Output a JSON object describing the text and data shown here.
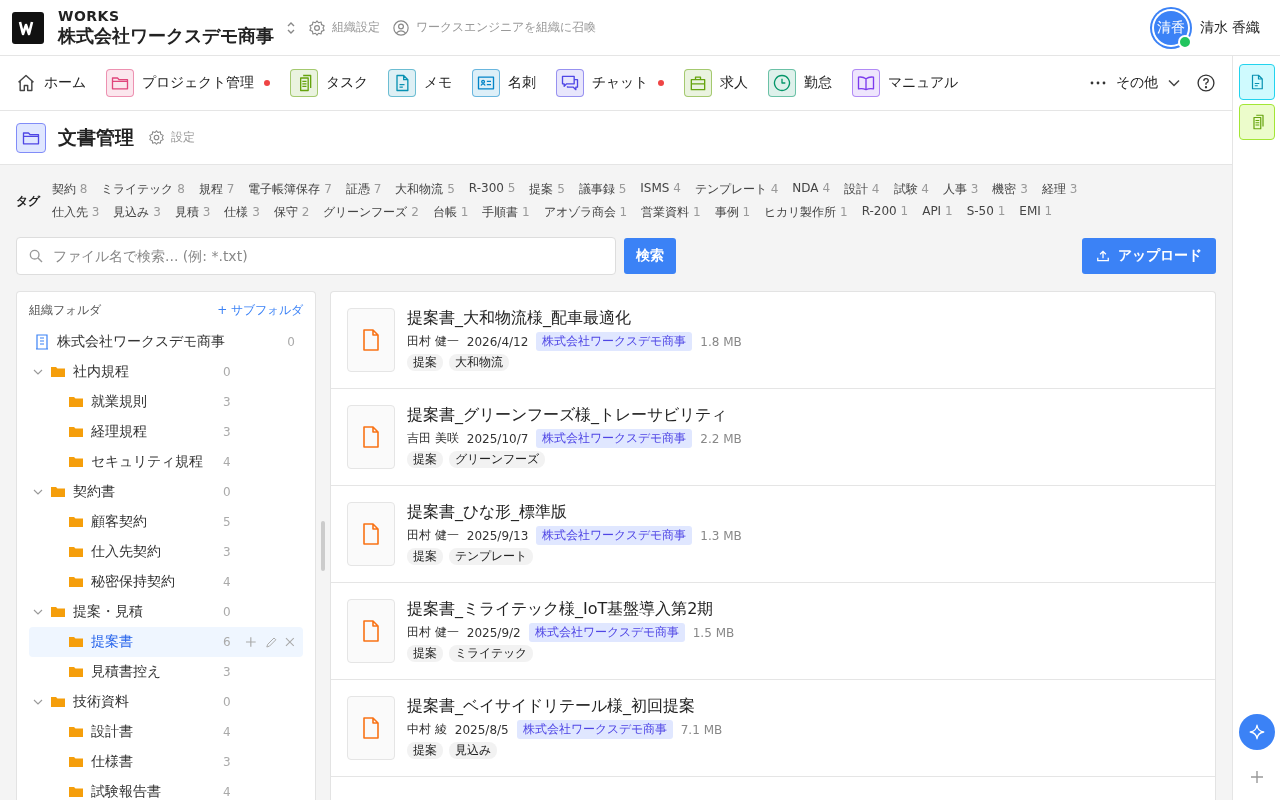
{
  "header": {
    "brand": "WORKS",
    "org": "株式会社ワークスデモ商事",
    "org_settings": "組織設定",
    "summon": "ワークスエンジニアを組織に召喚",
    "user": {
      "initials": "清香",
      "name": "清水 香織",
      "online": true
    }
  },
  "nav": {
    "items": [
      {
        "label": "ホーム",
        "kind": "plain",
        "badge": false
      },
      {
        "label": "プロジェクト管理",
        "kind": "app",
        "color": "#e0457b",
        "badge": true
      },
      {
        "label": "タスク",
        "kind": "app",
        "color": "#65a30d",
        "badge": false
      },
      {
        "label": "メモ",
        "kind": "app",
        "color": "#0891b2",
        "badge": false
      },
      {
        "label": "名刺",
        "kind": "app",
        "color": "#0284c7",
        "badge": false
      },
      {
        "label": "チャット",
        "kind": "app",
        "color": "#4f46e5",
        "badge": true
      },
      {
        "label": "求人",
        "kind": "app",
        "color": "#65a30d",
        "badge": false
      },
      {
        "label": "勤怠",
        "kind": "app",
        "color": "#059669",
        "badge": false
      },
      {
        "label": "マニュアル",
        "kind": "app",
        "color": "#7c3aed",
        "badge": false
      }
    ],
    "more": "その他"
  },
  "page": {
    "title": "文書管理",
    "settings": "設定"
  },
  "tags": {
    "label": "タグ",
    "items": [
      {
        "name": "契約",
        "count": "8"
      },
      {
        "name": "ミライテック",
        "count": "8"
      },
      {
        "name": "規程",
        "count": "7"
      },
      {
        "name": "電子帳簿保存",
        "count": "7"
      },
      {
        "name": "証憑",
        "count": "7"
      },
      {
        "name": "大和物流",
        "count": "5"
      },
      {
        "name": "R-300",
        "count": "5"
      },
      {
        "name": "提案",
        "count": "5"
      },
      {
        "name": "議事録",
        "count": "5"
      },
      {
        "name": "ISMS",
        "count": "4"
      },
      {
        "name": "テンプレート",
        "count": "4"
      },
      {
        "name": "NDA",
        "count": "4"
      },
      {
        "name": "設計",
        "count": "4"
      },
      {
        "name": "試験",
        "count": "4"
      },
      {
        "name": "人事",
        "count": "3"
      },
      {
        "name": "機密",
        "count": "3"
      },
      {
        "name": "経理",
        "count": "3"
      },
      {
        "name": "仕入先",
        "count": "3"
      },
      {
        "name": "見込み",
        "count": "3"
      },
      {
        "name": "見積",
        "count": "3"
      },
      {
        "name": "仕様",
        "count": "3"
      },
      {
        "name": "保守",
        "count": "2"
      },
      {
        "name": "グリーンフーズ",
        "count": "2"
      },
      {
        "name": "台帳",
        "count": "1"
      },
      {
        "name": "手順書",
        "count": "1"
      },
      {
        "name": "アオゾラ商会",
        "count": "1"
      },
      {
        "name": "営業資料",
        "count": "1"
      },
      {
        "name": "事例",
        "count": "1"
      },
      {
        "name": "ヒカリ製作所",
        "count": "1"
      },
      {
        "name": "R-200",
        "count": "1"
      },
      {
        "name": "API",
        "count": "1"
      },
      {
        "name": "S-50",
        "count": "1"
      },
      {
        "name": "EMI",
        "count": "1"
      }
    ]
  },
  "search": {
    "placeholder": "ファイル名で検索... (例: *.txt)",
    "button": "検索",
    "upload": "アップロード"
  },
  "folders": {
    "title": "組織フォルダ",
    "add": "+ サブフォルダ",
    "root": {
      "name": "株式会社ワークスデモ商事",
      "count": "0",
      "selected": false,
      "children": [
        {
          "name": "社内規程",
          "count": "0",
          "selected": false,
          "expanded": true,
          "children": [
            {
              "name": "就業規則",
              "count": "3",
              "selected": false
            },
            {
              "name": "経理規程",
              "count": "3",
              "selected": false
            },
            {
              "name": "セキュリティ規程",
              "count": "4",
              "selected": false
            }
          ]
        },
        {
          "name": "契約書",
          "count": "0",
          "selected": false,
          "expanded": true,
          "children": [
            {
              "name": "顧客契約",
              "count": "5",
              "selected": false
            },
            {
              "name": "仕入先契約",
              "count": "3",
              "selected": false
            },
            {
              "name": "秘密保持契約",
              "count": "4",
              "selected": false
            }
          ]
        },
        {
          "name": "提案・見積",
          "count": "0",
          "selected": false,
          "expanded": true,
          "children": [
            {
              "name": "提案書",
              "count": "6",
              "selected": true
            },
            {
              "name": "見積書控え",
              "count": "3",
              "selected": false
            }
          ]
        },
        {
          "name": "技術資料",
          "count": "0",
          "selected": false,
          "expanded": true,
          "children": [
            {
              "name": "設計書",
              "count": "4",
              "selected": false
            },
            {
              "name": "仕様書",
              "count": "3",
              "selected": false
            },
            {
              "name": "試験報告書",
              "count": "4",
              "selected": false
            }
          ]
        }
      ]
    }
  },
  "files": [
    {
      "title": "提案書_大和物流様_配車最適化",
      "owner": "田村 健一",
      "date": "2026/4/12",
      "org": "株式会社ワークスデモ商事",
      "size": "1.8 MB",
      "tags": [
        "提案",
        "大和物流"
      ]
    },
    {
      "title": "提案書_グリーンフーズ様_トレーサビリティ",
      "owner": "吉田 美咲",
      "date": "2025/10/7",
      "org": "株式会社ワークスデモ商事",
      "size": "2.2 MB",
      "tags": [
        "提案",
        "グリーンフーズ"
      ]
    },
    {
      "title": "提案書_ひな形_標準版",
      "owner": "田村 健一",
      "date": "2025/9/13",
      "org": "株式会社ワークスデモ商事",
      "size": "1.3 MB",
      "tags": [
        "提案",
        "テンプレート"
      ]
    },
    {
      "title": "提案書_ミライテック様_IoT基盤導入第2期",
      "owner": "田村 健一",
      "date": "2025/9/2",
      "org": "株式会社ワークスデモ商事",
      "size": "1.5 MB",
      "tags": [
        "提案",
        "ミライテック"
      ]
    },
    {
      "title": "提案書_ベイサイドリテール様_初回提案",
      "owner": "中村 綾",
      "date": "2025/8/5",
      "org": "株式会社ワークスデモ商事",
      "size": "7.1 MB",
      "tags": [
        "提案",
        "見込み"
      ]
    }
  ]
}
